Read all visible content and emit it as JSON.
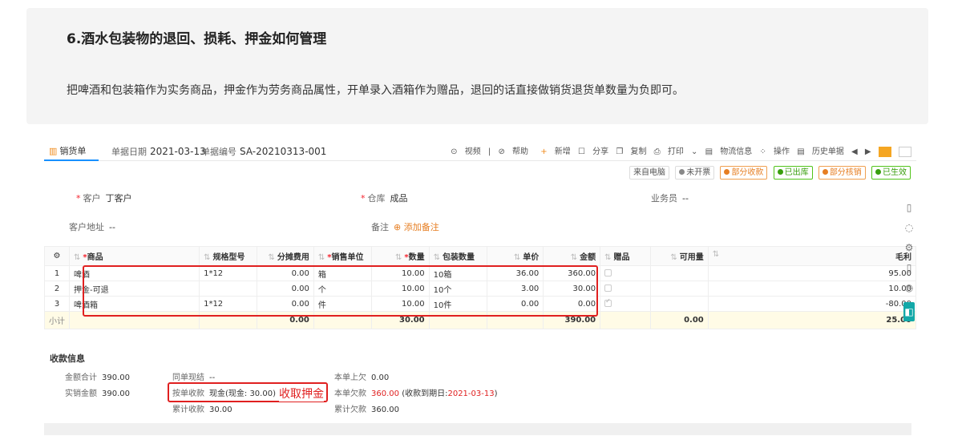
{
  "faq": {
    "title": "6.酒水包装物的退回、损耗、押金如何管理",
    "text": "把啤酒和包装箱作为实务商品，押金作为劳务商品属性，开单录入酒箱作为赠品，退回的话直接做销货退货单数量为负即可。"
  },
  "header": {
    "tab": "销货单",
    "date_label": "单据日期",
    "date": "2021-03-13",
    "no_label": "单据编号",
    "no": "SA-20210313-001"
  },
  "toolbar": {
    "video": "视频",
    "help": "帮助",
    "new": "新增",
    "share": "分享",
    "copy": "复制",
    "print": "打印",
    "logistics": "物流信息",
    "operate": "操作",
    "history": "历史单据"
  },
  "badges": {
    "source": "来自电脑",
    "invoice": "未开票",
    "partial_receive": "部分收款",
    "out": "已出库",
    "partial_writeoff": "部分核销",
    "effective": "已生效",
    "colors": {
      "orange": "#e67e22",
      "green": "#389e0d"
    }
  },
  "form": {
    "customer_label": "客户",
    "customer": "丁客户",
    "warehouse_label": "仓库",
    "warehouse": "成品",
    "salesman_label": "业务员",
    "salesman": "--",
    "address_label": "客户地址",
    "address": "--",
    "remark_label": "备注",
    "remark_add": "添加备注"
  },
  "table": {
    "headers": {
      "product": "商品",
      "spec": "规格型号",
      "fee": "分摊费用",
      "unit": "销售单位",
      "qty": "数量",
      "pack": "包装数量",
      "price": "单价",
      "amount": "金额",
      "gift": "赠品",
      "avail": "可用量",
      "profit": "毛利"
    },
    "rows": [
      {
        "idx": "1",
        "product": "啤酒",
        "spec": "1*12",
        "fee": "0.00",
        "unit": "箱",
        "qty": "10.00",
        "pack": "10箱",
        "price": "36.00",
        "amount": "360.00",
        "profit": "95.00"
      },
      {
        "idx": "2",
        "product": "押金-可退",
        "spec": "",
        "fee": "0.00",
        "unit": "个",
        "qty": "10.00",
        "pack": "10个",
        "price": "3.00",
        "amount": "30.00",
        "profit": "10.00"
      },
      {
        "idx": "3",
        "product": "啤酒箱",
        "spec": "1*12",
        "fee": "0.00",
        "unit": "件",
        "qty": "10.00",
        "pack": "10件",
        "price": "0.00",
        "amount": "0.00",
        "profit": "-80.00"
      }
    ],
    "subtotal": {
      "label": "小计",
      "fee": "0.00",
      "qty": "30.00",
      "amount": "390.00",
      "avail": "0.00",
      "profit": "25.00"
    }
  },
  "receipt": {
    "title": "收款信息",
    "total_label": "金额合计",
    "total": "390.00",
    "actual_label": "实销金额",
    "actual": "390.00",
    "same_label": "同单现结",
    "same": "--",
    "by_label": "按单收款",
    "by": "现金(现金: 30.00)",
    "cum_label": "累计收款",
    "cum": "30.00",
    "prev_label": "本单上欠",
    "prev": "0.00",
    "owe_label": "本单欠款",
    "owe": "360.00",
    "owe_note_prefix": "(收款到期日:",
    "owe_date": "2021-03-13",
    "owe_note_suffix": ")",
    "cum_owe_label": "累计欠款",
    "cum_owe": "360.00",
    "note": "收取押金"
  }
}
